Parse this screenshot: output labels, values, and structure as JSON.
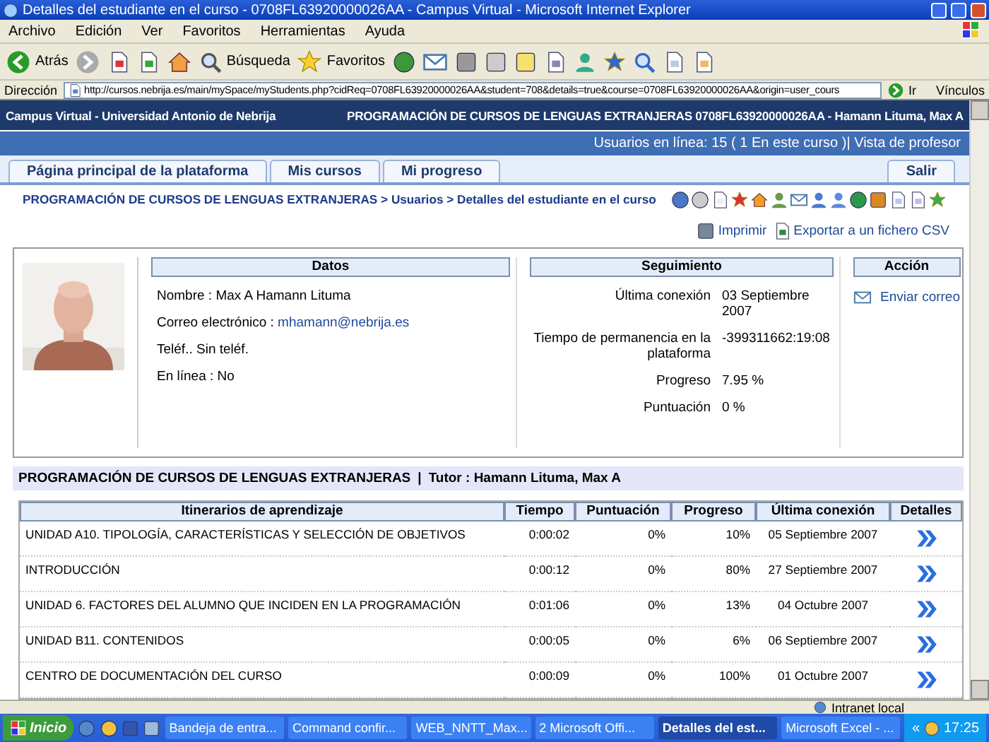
{
  "window": {
    "title": "Detalles del estudiante en el curso - 0708FL63920000026AA - Campus Virtual - Microsoft Internet Explorer"
  },
  "menu": [
    "Archivo",
    "Edición",
    "Ver",
    "Favoritos",
    "Herramientas",
    "Ayuda"
  ],
  "toolbar": {
    "back": "Atrás",
    "search": "Búsqueda",
    "favorites": "Favoritos"
  },
  "address": {
    "label": "Dirección",
    "url": "http://cursos.nebrija.es/main/mySpace/myStudents.php?cidReq=0708FL63920000026AA&student=708&details=true&course=0708FL63920000026AA&origin=user_cours",
    "go": "Ir",
    "links": "Vínculos"
  },
  "header": {
    "site": "Campus Virtual - Universidad Antonio de Nebrija",
    "course": "PROGRAMACIÓN DE CURSOS DE LENGUAS EXTRANJERAS 0708FL63920000026AA - Hamann Lituma, Max A"
  },
  "online_bar": "Usuarios en línea:  15  ( 1 En este curso  )| Vista de profesor",
  "tabs": [
    {
      "label": "Página principal de la plataforma",
      "selected": false
    },
    {
      "label": "Mis cursos",
      "selected": false
    },
    {
      "label": "Mi progreso",
      "selected": false
    }
  ],
  "logout": "Salir",
  "breadcrumb": "PROGRAMACIÓN DE CURSOS DE LENGUAS EXTRANJERAS > Usuarios > Detalles del estudiante en el curso",
  "actions": {
    "print": "Imprimir",
    "export": "Exportar a un fichero CSV"
  },
  "profile": {
    "datos_title": "Datos",
    "datos": [
      {
        "label": "Nombre :",
        "value": "Max A Hamann Lituma",
        "link": false
      },
      {
        "label": "Correo electrónico :",
        "value": "mhamann@nebrija.es",
        "link": true
      },
      {
        "label": "Teléf..",
        "value": "Sin teléf.",
        "link": false
      },
      {
        "label": "En línea :",
        "value": "No",
        "link": false
      }
    ],
    "seguimiento_title": "Seguimiento",
    "seguimiento": [
      {
        "label": "Última conexión",
        "value": "03 Septiembre 2007"
      },
      {
        "label": "Tiempo de permanencia en la plataforma",
        "value": "-399311662:19:08"
      },
      {
        "label": "Progreso",
        "value": "7.95 %"
      },
      {
        "label": "Puntuación",
        "value": "0 %"
      }
    ],
    "accion_title": "Acción",
    "send_mail": "Enviar correo"
  },
  "course_bar": {
    "title": "PROGRAMACIÓN DE CURSOS DE LENGUAS EXTRANJERAS",
    "separator": "|",
    "tutor": "Tutor : Hamann Lituma, Max A"
  },
  "table": {
    "columns": [
      "Itinerarios de aprendizaje",
      "Tiempo",
      "Puntuación",
      "Progreso",
      "Última conexión",
      "Detalles"
    ],
    "rows": [
      {
        "name": "UNIDAD A10. TIPOLOGÍA, CARACTERÍSTICAS Y SELECCIÓN DE OBJETIVOS",
        "time": "0:00:02",
        "score": "0%",
        "progress": "10%",
        "last": "05 Septiembre 2007"
      },
      {
        "name": "INTRODUCCIÓN",
        "time": "0:00:12",
        "score": "0%",
        "progress": "80%",
        "last": "27 Septiembre 2007"
      },
      {
        "name": "UNIDAD 6. FACTORES DEL ALUMNO QUE INCIDEN EN LA PROGRAMACIÓN",
        "time": "0:01:06",
        "score": "0%",
        "progress": "13%",
        "last": "04 Octubre 2007"
      },
      {
        "name": "UNIDAD B11. CONTENIDOS",
        "time": "0:00:05",
        "score": "0%",
        "progress": "6%",
        "last": "06 Septiembre 2007"
      },
      {
        "name": "CENTRO DE DOCUMENTACIÓN DEL CURSO",
        "time": "0:00:09",
        "score": "0%",
        "progress": "100%",
        "last": "01 Octubre 2007"
      }
    ]
  },
  "status_bar": {
    "zone": "Intranet local"
  },
  "taskbar": {
    "start": "Inicio",
    "items": [
      {
        "label": "Bandeja de entra...",
        "selected": false
      },
      {
        "label": "Command confir...",
        "selected": false
      },
      {
        "label": "WEB_NNTT_Max...",
        "selected": false
      },
      {
        "label": "2 Microsoft Offi...",
        "selected": false
      },
      {
        "label": "Detalles del est...",
        "selected": true
      },
      {
        "label": "Microsoft Excel - ...",
        "selected": false
      }
    ],
    "tray_toggle": "«",
    "clock": "17:25"
  }
}
